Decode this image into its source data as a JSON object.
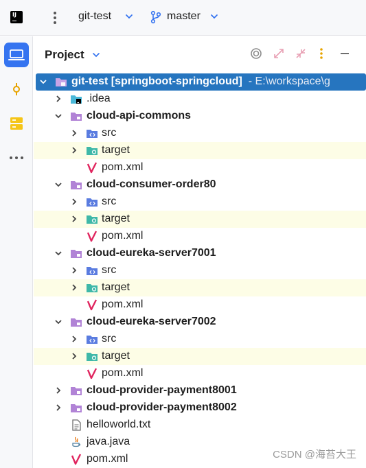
{
  "toolbar": {
    "project_name": "git-test",
    "branch": "master",
    "app_logo_text": "IJ"
  },
  "sidebar_strip": {
    "items": [
      {
        "name": "project-view",
        "icon": "laptop-icon",
        "active": true
      },
      {
        "name": "commit",
        "icon": "commit-icon",
        "active": false
      },
      {
        "name": "structure",
        "icon": "database-icon",
        "active": false
      },
      {
        "name": "more",
        "icon": "more-icon",
        "active": false
      }
    ]
  },
  "panel": {
    "title": "Project",
    "tool_icons": [
      "target-icon",
      "expand-icon",
      "collapse-icon",
      "options-icon",
      "minimize-icon"
    ]
  },
  "tree": {
    "root": {
      "name": "git-test",
      "qualifier": "[springboot-springcloud]",
      "path": "- E:\\workspace\\g"
    },
    "rows": [
      {
        "label": "git-test",
        "level": 0
      },
      {
        "label": ".idea",
        "level": 1
      },
      {
        "label": "cloud-api-commons",
        "level": 1
      },
      {
        "label": "src",
        "level": 2
      },
      {
        "label": "target",
        "level": 2
      },
      {
        "label": "pom.xml",
        "level": 2
      },
      {
        "label": "cloud-consumer-order80",
        "level": 1
      },
      {
        "label": "src",
        "level": 2
      },
      {
        "label": "target",
        "level": 2
      },
      {
        "label": "pom.xml",
        "level": 2
      },
      {
        "label": "cloud-eureka-server7001",
        "level": 1
      },
      {
        "label": "src",
        "level": 2
      },
      {
        "label": "target",
        "level": 2
      },
      {
        "label": "pom.xml",
        "level": 2
      },
      {
        "label": "cloud-eureka-server7002",
        "level": 1
      },
      {
        "label": "src",
        "level": 2
      },
      {
        "label": "target",
        "level": 2
      },
      {
        "label": "pom.xml",
        "level": 2
      },
      {
        "label": "cloud-provider-payment8001",
        "level": 1
      },
      {
        "label": "cloud-provider-payment8002",
        "level": 1
      },
      {
        "label": "helloworld.txt",
        "level": 1
      },
      {
        "label": "java.java",
        "level": 1
      },
      {
        "label": "pom.xml",
        "level": 1
      }
    ]
  },
  "watermark": "CSDN @海苔大王",
  "colors": {
    "selection": "#2675bf",
    "highlight_row": "#fdfde6",
    "accent": "#3574f0",
    "module_folder": "#b183d6",
    "source_folder": "#5a7ce0",
    "target_folder": "#3fb8a8",
    "maven": "#e0245e"
  }
}
